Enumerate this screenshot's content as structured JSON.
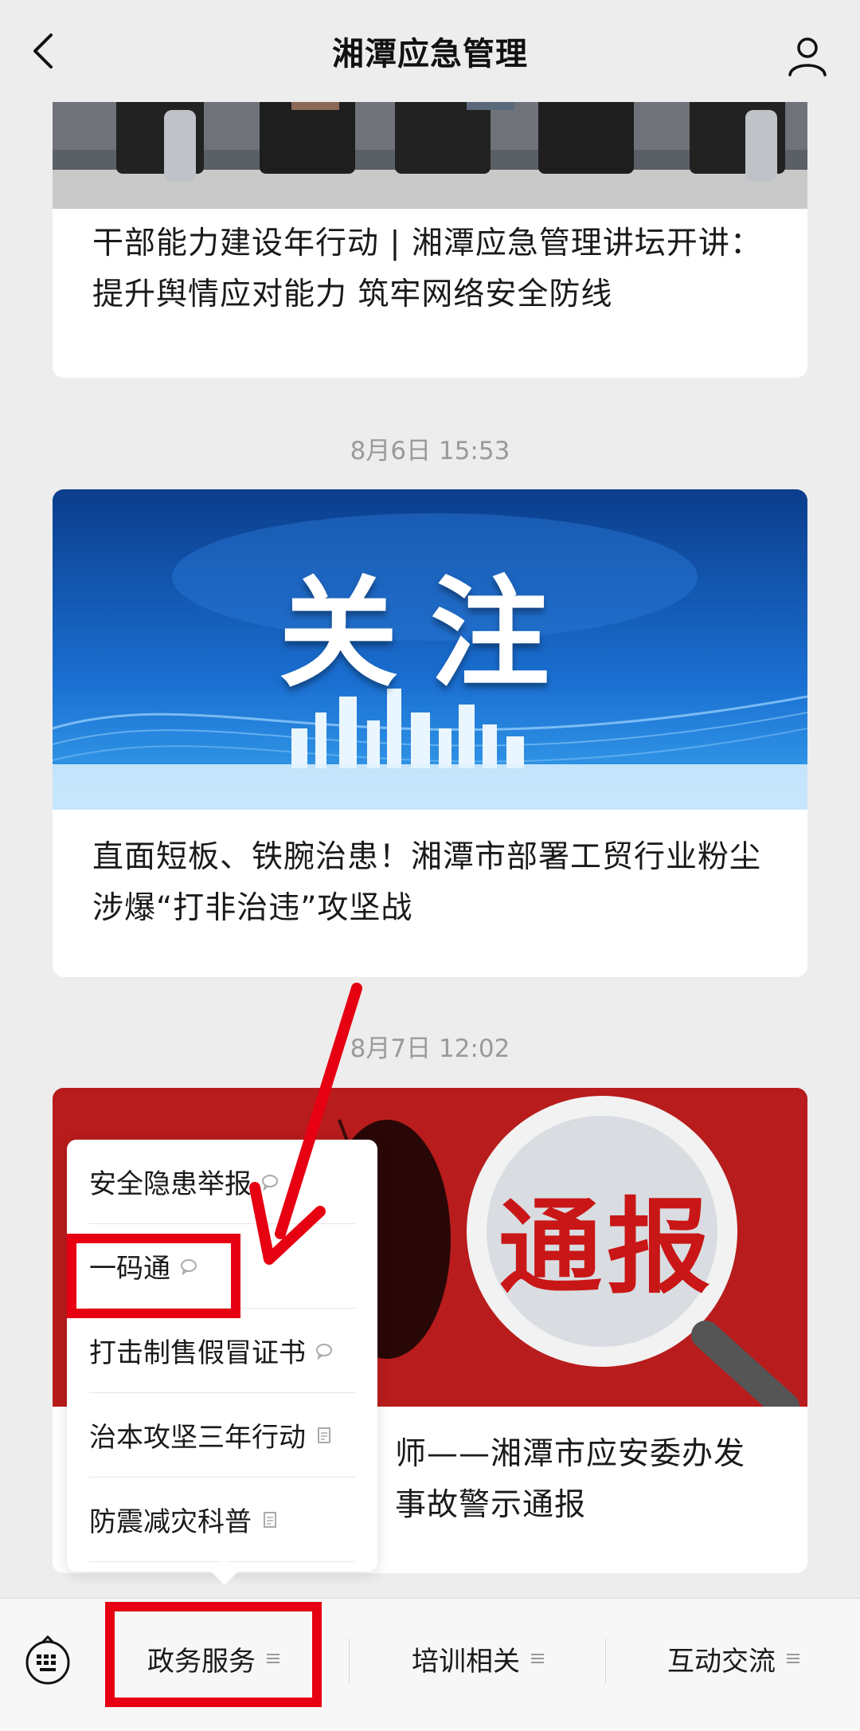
{
  "header": {
    "title": "湘潭应急管理"
  },
  "feed": {
    "card1": {
      "title": "干部能力建设年行动 | 湘潭应急管理讲坛开讲：提升舆情应对能力 筑牢网络安全防线"
    },
    "timestamp1": "8月6日 15:53",
    "card2": {
      "cover_text": "关注",
      "title": "直面短板、铁腕治患！湘潭市部署工贸行业粉尘涉爆“打非治违”攻坚战"
    },
    "timestamp2": "8月7日 12:02",
    "card3": {
      "cover_text": "通报",
      "title_visible": "师——湘潭市应安委办发\n事故警示通报"
    }
  },
  "popup_menu": {
    "items": [
      {
        "label": "安全隐患举报",
        "icon": "chat-bubble-icon"
      },
      {
        "label": "一码通",
        "icon": "chat-bubble-icon"
      },
      {
        "label": "打击制售假冒证书",
        "icon": "chat-bubble-icon"
      },
      {
        "label": "治本攻坚三年行动",
        "icon": "document-icon"
      },
      {
        "label": "防震减灾科普",
        "icon": "document-icon"
      }
    ]
  },
  "bottom_bar": {
    "tabs": [
      {
        "label": "政务服务"
      },
      {
        "label": "培训相关"
      },
      {
        "label": "互动交流"
      }
    ]
  },
  "colors": {
    "annotation_red": "#e60012",
    "background": "#ededed"
  }
}
